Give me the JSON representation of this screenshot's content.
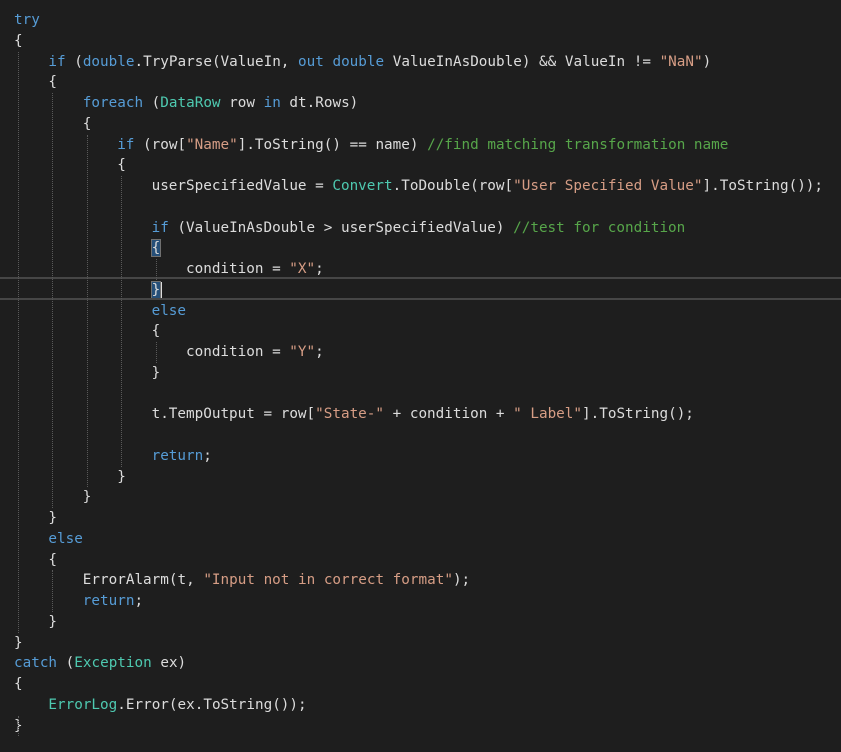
{
  "code_lines": [
    {
      "indent": 0,
      "tokens": [
        {
          "t": "kw",
          "v": "try"
        }
      ]
    },
    {
      "indent": 0,
      "tokens": [
        {
          "t": "id",
          "v": "{"
        }
      ]
    },
    {
      "indent": 1,
      "tokens": [
        {
          "t": "kw",
          "v": "if"
        },
        {
          "t": "id",
          "v": " ("
        },
        {
          "t": "kw",
          "v": "double"
        },
        {
          "t": "id",
          "v": ".TryParse(ValueIn, "
        },
        {
          "t": "kw",
          "v": "out"
        },
        {
          "t": "id",
          "v": " "
        },
        {
          "t": "kw",
          "v": "double"
        },
        {
          "t": "id",
          "v": " ValueInAsDouble) && ValueIn != "
        },
        {
          "t": "str",
          "v": "\"NaN\""
        },
        {
          "t": "id",
          "v": ")"
        }
      ]
    },
    {
      "indent": 1,
      "tokens": [
        {
          "t": "id",
          "v": "{"
        }
      ]
    },
    {
      "indent": 2,
      "tokens": [
        {
          "t": "kw",
          "v": "foreach"
        },
        {
          "t": "id",
          "v": " ("
        },
        {
          "t": "type",
          "v": "DataRow"
        },
        {
          "t": "id",
          "v": " row "
        },
        {
          "t": "kw",
          "v": "in"
        },
        {
          "t": "id",
          "v": " dt.Rows)"
        }
      ]
    },
    {
      "indent": 2,
      "tokens": [
        {
          "t": "id",
          "v": "{"
        }
      ]
    },
    {
      "indent": 3,
      "tokens": [
        {
          "t": "kw",
          "v": "if"
        },
        {
          "t": "id",
          "v": " (row["
        },
        {
          "t": "str",
          "v": "\"Name\""
        },
        {
          "t": "id",
          "v": "].ToString() == name) "
        },
        {
          "t": "cmt",
          "v": "//find matching transformation name"
        }
      ]
    },
    {
      "indent": 3,
      "tokens": [
        {
          "t": "id",
          "v": "{"
        }
      ]
    },
    {
      "indent": 4,
      "tokens": [
        {
          "t": "id",
          "v": "userSpecifiedValue = "
        },
        {
          "t": "type",
          "v": "Convert"
        },
        {
          "t": "id",
          "v": ".ToDouble(row["
        },
        {
          "t": "str",
          "v": "\"User Specified Value\""
        },
        {
          "t": "id",
          "v": "].ToString());"
        }
      ]
    },
    {
      "indent": 4,
      "tokens": []
    },
    {
      "indent": 4,
      "tokens": [
        {
          "t": "kw",
          "v": "if"
        },
        {
          "t": "id",
          "v": " (ValueInAsDouble > userSpecifiedValue) "
        },
        {
          "t": "cmt",
          "v": "//test for condition"
        }
      ]
    },
    {
      "indent": 4,
      "tokens": [
        {
          "t": "id",
          "v": "{",
          "hl": true
        }
      ]
    },
    {
      "indent": 5,
      "tokens": [
        {
          "t": "id",
          "v": "condition = "
        },
        {
          "t": "str",
          "v": "\"X\""
        },
        {
          "t": "id",
          "v": ";"
        }
      ]
    },
    {
      "indent": 4,
      "tokens": [
        {
          "t": "id",
          "v": "}",
          "hl": true,
          "caret": true
        }
      ]
    },
    {
      "indent": 4,
      "tokens": [
        {
          "t": "kw",
          "v": "else"
        }
      ]
    },
    {
      "indent": 4,
      "tokens": [
        {
          "t": "id",
          "v": "{"
        }
      ]
    },
    {
      "indent": 5,
      "tokens": [
        {
          "t": "id",
          "v": "condition = "
        },
        {
          "t": "str",
          "v": "\"Y\""
        },
        {
          "t": "id",
          "v": ";"
        }
      ]
    },
    {
      "indent": 4,
      "tokens": [
        {
          "t": "id",
          "v": "}"
        }
      ]
    },
    {
      "indent": 4,
      "tokens": []
    },
    {
      "indent": 4,
      "tokens": [
        {
          "t": "id",
          "v": "t.TempOutput = row["
        },
        {
          "t": "str",
          "v": "\"State-\""
        },
        {
          "t": "id",
          "v": " + condition + "
        },
        {
          "t": "str",
          "v": "\" Label\""
        },
        {
          "t": "id",
          "v": "].ToString();"
        }
      ]
    },
    {
      "indent": 4,
      "tokens": []
    },
    {
      "indent": 4,
      "tokens": [
        {
          "t": "kw",
          "v": "return"
        },
        {
          "t": "id",
          "v": ";"
        }
      ]
    },
    {
      "indent": 3,
      "tokens": [
        {
          "t": "id",
          "v": "}"
        }
      ]
    },
    {
      "indent": 2,
      "tokens": [
        {
          "t": "id",
          "v": "}"
        }
      ]
    },
    {
      "indent": 1,
      "tokens": [
        {
          "t": "id",
          "v": "}"
        }
      ]
    },
    {
      "indent": 1,
      "tokens": [
        {
          "t": "kw",
          "v": "else"
        }
      ]
    },
    {
      "indent": 1,
      "tokens": [
        {
          "t": "id",
          "v": "{"
        }
      ]
    },
    {
      "indent": 2,
      "tokens": [
        {
          "t": "id",
          "v": "ErrorAlarm(t, "
        },
        {
          "t": "str",
          "v": "\"Input not in correct format\""
        },
        {
          "t": "id",
          "v": ");"
        }
      ]
    },
    {
      "indent": 2,
      "tokens": [
        {
          "t": "kw",
          "v": "return"
        },
        {
          "t": "id",
          "v": ";"
        }
      ]
    },
    {
      "indent": 1,
      "tokens": [
        {
          "t": "id",
          "v": "}"
        }
      ]
    },
    {
      "indent": 0,
      "tokens": [
        {
          "t": "id",
          "v": "}"
        }
      ]
    },
    {
      "indent": 0,
      "tokens": [
        {
          "t": "kw",
          "v": "catch"
        },
        {
          "t": "id",
          "v": " ("
        },
        {
          "t": "type",
          "v": "Exception"
        },
        {
          "t": "id",
          "v": " ex)"
        }
      ]
    },
    {
      "indent": 0,
      "tokens": [
        {
          "t": "id",
          "v": "{"
        }
      ]
    },
    {
      "indent": 1,
      "tokens": [
        {
          "t": "type",
          "v": "ErrorLog"
        },
        {
          "t": "id",
          "v": ".Error(ex.ToString());"
        }
      ]
    },
    {
      "indent": 0,
      "tokens": [
        {
          "t": "id",
          "v": "}"
        }
      ]
    }
  ],
  "colors": {
    "background": "#1e1e1e",
    "keyword": "#569cd6",
    "type": "#4ec9b0",
    "string": "#d69d85",
    "comment": "#57a64a",
    "text": "#dcdcdc"
  }
}
